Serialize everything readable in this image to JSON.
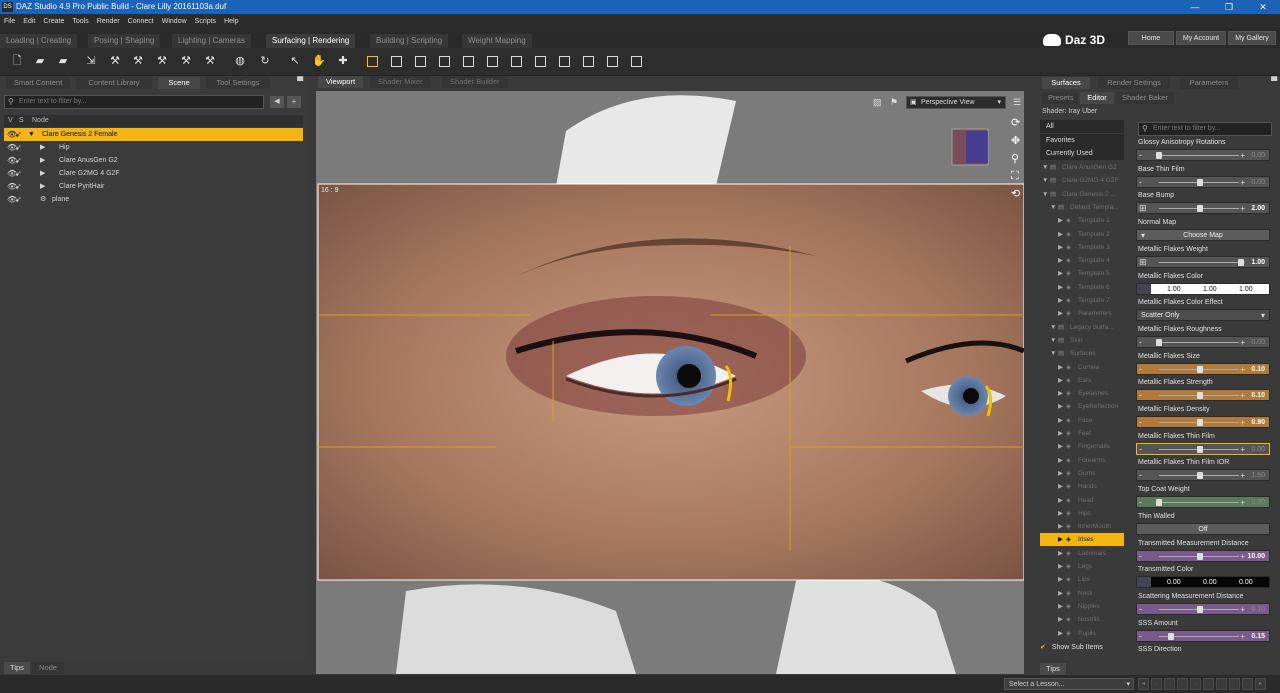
{
  "window": {
    "app_icon_text": "DS",
    "title": "DAZ Studio 4.9 Pro Public Build - Clare Lilly 20161103a.duf",
    "controls": [
      "—",
      "❐",
      "✕"
    ]
  },
  "menu": [
    "File",
    "Edit",
    "Create",
    "Tools",
    "Render",
    "Connect",
    "Window",
    "Scripts",
    "Help"
  ],
  "layout_tabs": [
    {
      "label": "Loading | Creating",
      "active": false
    },
    {
      "label": "Posing | Shaping",
      "active": false
    },
    {
      "label": "Lighting | Cameras",
      "active": false
    },
    {
      "label": "Surfacing | Rendering",
      "active": true
    },
    {
      "label": "Building | Scripting",
      "active": false
    },
    {
      "label": "Weight Mapping",
      "active": false
    }
  ],
  "brand": {
    "logo": "Daz 3D",
    "buttons": [
      "Home",
      "My Account",
      "My Gallery"
    ]
  },
  "left_panel": {
    "tabs": [
      {
        "label": "Smart Content",
        "active": false
      },
      {
        "label": "Content Library",
        "active": false
      },
      {
        "label": "Scene",
        "active": true
      },
      {
        "label": "Tool Settings",
        "active": false
      }
    ],
    "filter_placeholder": "Enter text to filter by...",
    "header": {
      "v": "V",
      "s": "S",
      "node": "Node"
    },
    "nodes": [
      {
        "label": "Clare Genesis 2 Female",
        "selected": true,
        "indent": 0
      },
      {
        "label": "Hip",
        "selected": false,
        "indent": 1
      },
      {
        "label": "Clare AnusGen G2",
        "selected": false,
        "indent": 1
      },
      {
        "label": "Clare G2MG 4 G2F",
        "selected": false,
        "indent": 1
      },
      {
        "label": "Clare PyritHair",
        "selected": false,
        "indent": 1
      },
      {
        "label": "plane",
        "selected": false,
        "indent": 0
      }
    ],
    "bottom_tabs": [
      "Tips",
      "Node"
    ]
  },
  "center_panel": {
    "tabs": [
      {
        "label": "Viewport",
        "active": true
      },
      {
        "label": "Shader Mixer",
        "active": false
      },
      {
        "label": "Shader Builder",
        "active": false
      }
    ],
    "view_select": "Perspective View",
    "aspect_label": "16 : 9"
  },
  "right_panel": {
    "tabs": [
      {
        "label": "Surfaces",
        "active": true
      },
      {
        "label": "Render Settings",
        "active": false
      },
      {
        "label": "Parameters",
        "active": false
      }
    ],
    "subtabs": [
      {
        "label": "Presets",
        "active": false
      },
      {
        "label": "Editor",
        "active": true
      },
      {
        "label": "Shader Baker",
        "active": false
      }
    ],
    "shader": "Shader: Iray Uber",
    "categories": [
      "All",
      "Favorites",
      "Currently Used"
    ],
    "tree": [
      {
        "label": "Clare AnusGen G2",
        "indent": 0,
        "highlight": false
      },
      {
        "label": "Clare G2MG 4 G2F",
        "indent": 0,
        "highlight": false
      },
      {
        "label": "Clare Genesis 2 ...",
        "indent": 0,
        "highlight": false
      },
      {
        "label": "Default Templa...",
        "indent": 1,
        "highlight": false
      },
      {
        "label": "Template 1",
        "indent": 2,
        "highlight": false
      },
      {
        "label": "Template 2",
        "indent": 2,
        "highlight": false
      },
      {
        "label": "Template 3",
        "indent": 2,
        "highlight": false
      },
      {
        "label": "Template 4",
        "indent": 2,
        "highlight": false
      },
      {
        "label": "Template 5",
        "indent": 2,
        "highlight": false
      },
      {
        "label": "Template 6",
        "indent": 2,
        "highlight": false
      },
      {
        "label": "Template 7",
        "indent": 2,
        "highlight": false
      },
      {
        "label": "Parameters",
        "indent": 2,
        "highlight": false
      },
      {
        "label": "Legacy Surfa...",
        "indent": 1,
        "highlight": false
      },
      {
        "label": "Skin",
        "indent": 1,
        "highlight": false
      },
      {
        "label": "Surfaces",
        "indent": 1,
        "highlight": false
      },
      {
        "label": "Cornea",
        "indent": 2,
        "highlight": false
      },
      {
        "label": "Ears",
        "indent": 2,
        "highlight": false
      },
      {
        "label": "Eyelashes",
        "indent": 2,
        "highlight": false
      },
      {
        "label": "EyeReflection",
        "indent": 2,
        "highlight": false
      },
      {
        "label": "Face",
        "indent": 2,
        "highlight": false
      },
      {
        "label": "Feet",
        "indent": 2,
        "highlight": false
      },
      {
        "label": "Fingernails",
        "indent": 2,
        "highlight": false
      },
      {
        "label": "Forearms",
        "indent": 2,
        "highlight": false
      },
      {
        "label": "Gums",
        "indent": 2,
        "highlight": false
      },
      {
        "label": "Hands",
        "indent": 2,
        "highlight": false
      },
      {
        "label": "Head",
        "indent": 2,
        "highlight": false
      },
      {
        "label": "Hips",
        "indent": 2,
        "highlight": false
      },
      {
        "label": "InnerMouth",
        "indent": 2,
        "highlight": false
      },
      {
        "label": "Irises",
        "indent": 2,
        "highlight": true
      },
      {
        "label": "Lacrimals",
        "indent": 2,
        "highlight": false
      },
      {
        "label": "Legs",
        "indent": 2,
        "highlight": false
      },
      {
        "label": "Lips",
        "indent": 2,
        "highlight": false
      },
      {
        "label": "Neck",
        "indent": 2,
        "highlight": false
      },
      {
        "label": "Nipples",
        "indent": 2,
        "highlight": false
      },
      {
        "label": "Nostrils",
        "indent": 2,
        "highlight": false
      },
      {
        "label": "Pupils",
        "indent": 2,
        "highlight": false
      }
    ],
    "show_sub_items": "Show Sub Items",
    "props_filter": "Enter text to filter by...",
    "properties": [
      {
        "label": "Glossy Anisotropy Rotations",
        "value": "0.00",
        "fill": 0.0,
        "dim": true
      },
      {
        "label": "Base Thin Film",
        "value": "0.00",
        "fill": 0.5,
        "dim": true
      },
      {
        "label": "Base Bump",
        "value": "2.00",
        "fill": 0.5,
        "dim": false,
        "map": true
      },
      {
        "label": "Normal Map",
        "value": "Choose Map",
        "type": "map"
      },
      {
        "label": "Metallic Flakes Weight",
        "value": "1.00",
        "fill": 1.0,
        "dim": false,
        "map": true
      },
      {
        "label": "Metallic Flakes Color",
        "values": [
          "1.00",
          "1.00",
          "1.00"
        ],
        "type": "color"
      },
      {
        "label": "Metallic Flakes Color Effect",
        "value": "Scatter Only",
        "type": "select"
      },
      {
        "label": "Metallic Flakes Roughness",
        "value": "0.00",
        "fill": 0.0,
        "dim": true
      },
      {
        "label": "Metallic Flakes Size",
        "value": "0.10",
        "fill": 0.5,
        "dim": false,
        "color": "#b07a3a"
      },
      {
        "label": "Metallic Flakes Strength",
        "value": "0.10",
        "fill": 0.5,
        "dim": false,
        "color": "#b07a3a"
      },
      {
        "label": "Metallic Flakes Density",
        "value": "0.90",
        "fill": 0.5,
        "dim": false,
        "color": "#b07a3a"
      },
      {
        "label": "Metallic Flakes Thin Film",
        "value": "0.00",
        "fill": 0.5,
        "dim": true,
        "selected": true
      },
      {
        "label": "Metallic Flakes Thin Film IOR",
        "value": "1.50",
        "fill": 0.5,
        "dim": true
      },
      {
        "label": "Top Coat Weight",
        "value": "0.00",
        "fill": 0.0,
        "dim": true,
        "color": "#5a7a5a"
      },
      {
        "label": "Thin Walled",
        "value": "Off",
        "type": "toggle"
      },
      {
        "label": "Transmitted Measurement Distance",
        "value": "10.00",
        "fill": 0.5,
        "dim": false,
        "color": "#7a5a8a"
      },
      {
        "label": "Transmitted Color",
        "values": [
          "0.00",
          "0.00",
          "0.00"
        ],
        "type": "color"
      },
      {
        "label": "Scattering Measurement Distance",
        "value": "0.10",
        "fill": 0.5,
        "dim": true,
        "color": "#7a5a8a"
      },
      {
        "label": "SSS Amount",
        "value": "0.15",
        "fill": 0.15,
        "dim": false,
        "color": "#7a5a8a"
      },
      {
        "label": "SSS Direction",
        "value": "",
        "type": "header"
      }
    ],
    "bottom_tabs": [
      "Tips"
    ]
  },
  "status": {
    "lesson_select": "Select a Lesson..."
  },
  "colors": {
    "accent": "#f2b514",
    "title_bar": "#1a63b8"
  }
}
